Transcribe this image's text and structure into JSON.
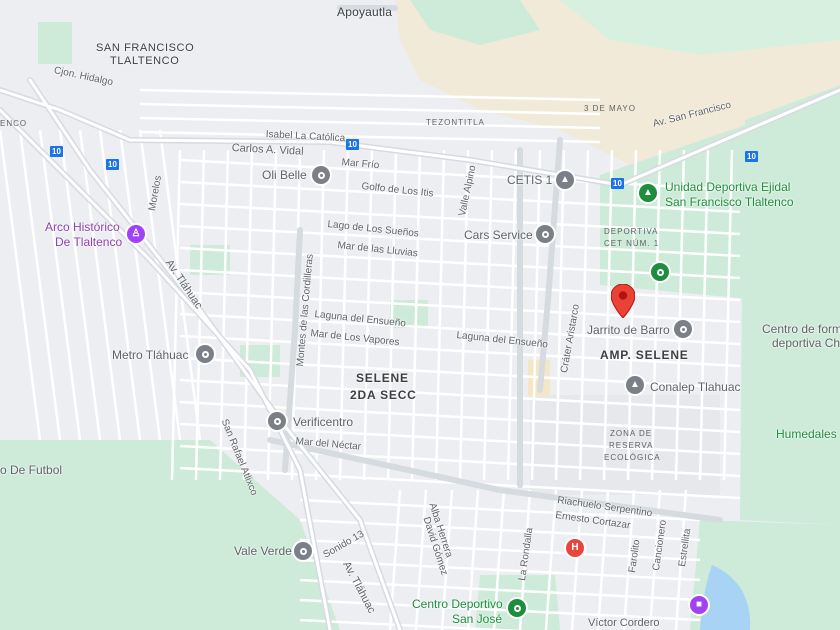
{
  "map": {
    "colors": {
      "park": "#cdebd8",
      "land": "#eceef1",
      "road": "#ffffff",
      "arterial": "#d6dbe0",
      "sand": "#f1ead8",
      "water": "#a8d3f5",
      "pin": "#ea4335"
    },
    "areas": {
      "apoyautla": "Apoyautla",
      "san_francisco_1": "SAN FRANCISCO",
      "san_francisco_2": "TLALTENCO",
      "selene_1": "SELENE",
      "selene_2": "2DA SECC",
      "amp_selene": "AMP. SELENE",
      "deportiva_1": "DEPORTIVA",
      "deportiva_2": "CET NÚM. 1",
      "reserva_1": "ZONA DE",
      "reserva_2": "RESERVA",
      "reserva_3": "ECOLÓGICA",
      "tezontitla": "TEZONTITLA",
      "enco": "ENCO"
    },
    "streets": {
      "cjon_hidalgo": "Cjon. Hidalgo",
      "isabel": "Isabel La Católica",
      "carlos_vidal": "Carlos A. Vidal",
      "mar_frio": "Mar Frío",
      "golfo": "Golfo de Los Itis",
      "valle_alpino": "Valle Alpino",
      "lago_suenos": "Lago de Los Sueños",
      "mar_lluvias": "Mar de las Lluvias",
      "montes": "Montes de las Cordilleras",
      "laguna_1": "Laguna del Ensueño",
      "laguna_2": "Laguna del Ensueño",
      "mar_vapores": "Mar de Los Vapores",
      "crater": "Cráter Aristarco",
      "av_tlahuac_1": "Av. Tláhuac",
      "av_tlahuac_2": "Av. Tláhuac",
      "morelos": "Morelos",
      "san_rafael": "San Rafael Atlixco",
      "mar_nectar": "Mar del Néctar",
      "sonido": "Sonido 13",
      "alba": "Alba Herrera",
      "david": "David Gómez",
      "riachuelo": "Riachuelo Serpentino",
      "ernesto": "Ernesto Cortazar",
      "la_rondalla": "La Rondalla",
      "farolito": "Farolito",
      "cancionero": "Cancionero",
      "estrellita": "Estrellita",
      "tres_mayo": "3 DE MAYO",
      "av_san_francisco": "Av. San Francisco"
    },
    "route_shield": "10",
    "pois": {
      "oli_belle": "Oli Belle",
      "cetis": "CETIS 1",
      "unidad_1": "Unidad Deportiva Ejidal",
      "unidad_2": "San Francisco Tlaltenco",
      "arco_1": "Arco Histórico",
      "arco_2": "De Tlaltenco",
      "cars_service": "Cars Service",
      "jarrito": "Jarrito de Barro",
      "centro_forma_1": "Centro de form",
      "centro_forma_2": "deportiva Ch",
      "metro": "Metro Tláhuac",
      "conalep": "Conalep Tlahuac",
      "verificentro": "Verificentro",
      "humedales": "Humedales",
      "futbol": "o De Futbol",
      "vale_verde": "Vale Verde",
      "centro_deportivo_1": "Centro Deportivo",
      "centro_deportivo_2": "San José",
      "victor": "Víctor Cordero"
    },
    "icons": {
      "poi": "map-poi-icon",
      "park": "park-icon",
      "school": "school-icon",
      "hospital": "hospital-icon",
      "landmark": "landmark-icon",
      "pin": "location-pin-icon"
    }
  }
}
